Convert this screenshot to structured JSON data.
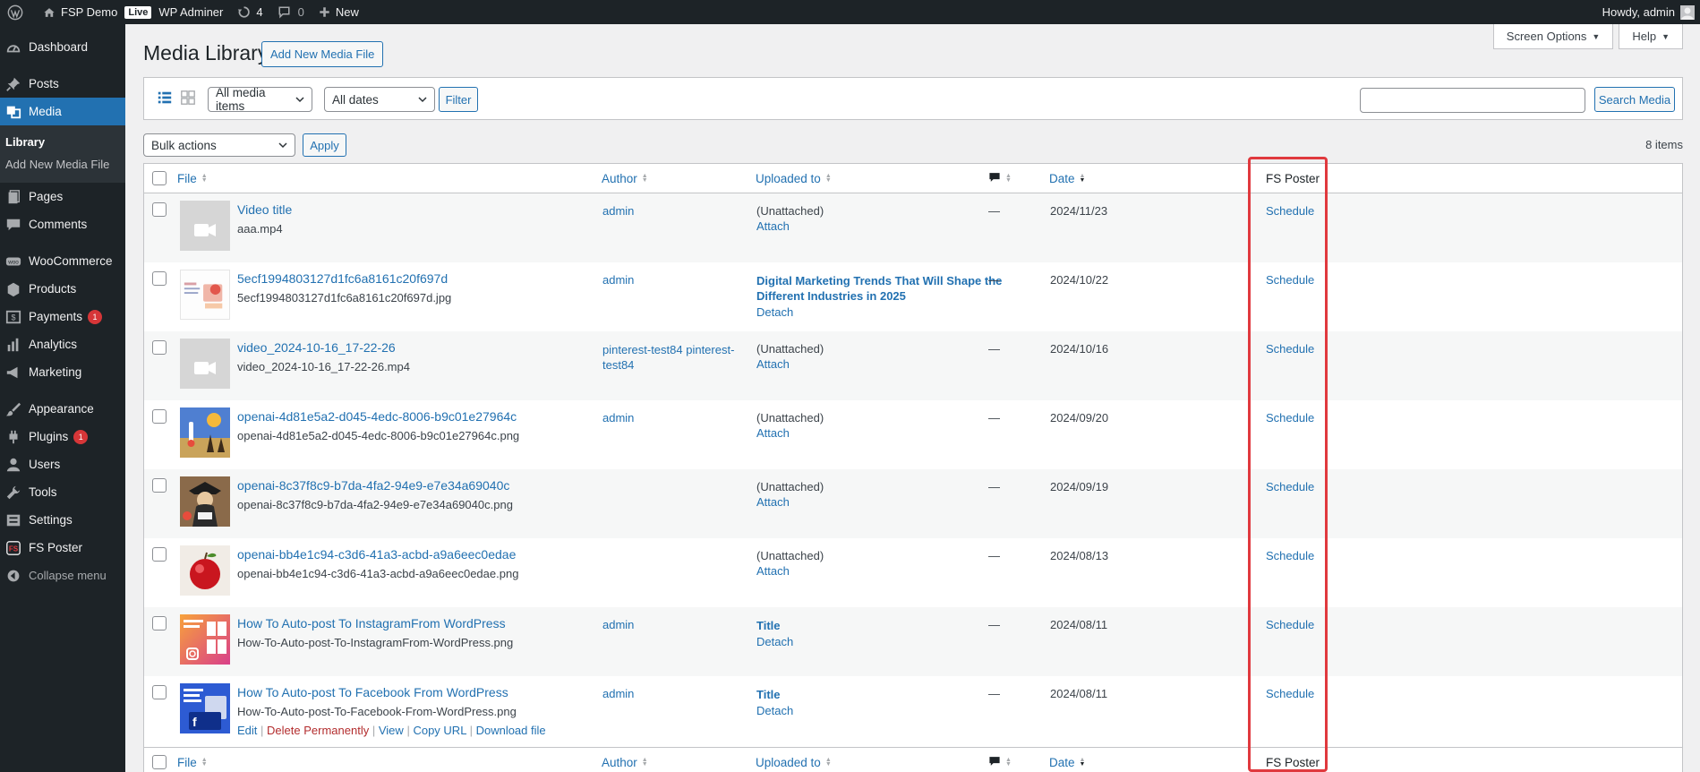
{
  "admin_bar": {
    "site_name": "FSP Demo",
    "live_badge": "Live",
    "wp_adminer": "WP Adminer",
    "updates_count": "4",
    "comments_count": "0",
    "new_label": "New",
    "howdy": "Howdy, admin"
  },
  "sidebar": {
    "dashboard": "Dashboard",
    "posts": "Posts",
    "media": "Media",
    "library": "Library",
    "add_new_media": "Add New Media File",
    "pages": "Pages",
    "comments": "Comments",
    "woocommerce": "WooCommerce",
    "products": "Products",
    "payments": "Payments",
    "payments_badge": "1",
    "analytics": "Analytics",
    "marketing": "Marketing",
    "appearance": "Appearance",
    "plugins": "Plugins",
    "plugins_badge": "1",
    "users": "Users",
    "tools": "Tools",
    "settings": "Settings",
    "fs_poster": "FS Poster",
    "collapse": "Collapse menu"
  },
  "header": {
    "title": "Media Library",
    "add_new": "Add New Media File",
    "screen_options": "Screen Options",
    "help": "Help"
  },
  "filters": {
    "media_type": "All media items",
    "dates": "All dates",
    "filter_button": "Filter",
    "search_button": "Search Media",
    "search_value": ""
  },
  "bulk": {
    "bulk_actions": "Bulk actions",
    "apply": "Apply",
    "items_count": "8 items"
  },
  "columns": {
    "file": "File",
    "author": "Author",
    "uploaded_to": "Uploaded to",
    "date": "Date",
    "fs_poster": "FS Poster"
  },
  "rows": [
    {
      "title": "Video title",
      "filename": "aaa.mp4",
      "author": "admin",
      "uploaded": "(Unattached)",
      "action": "Attach",
      "comments": "—",
      "date": "2024/11/23",
      "fs": "Schedule"
    },
    {
      "title": "5ecf1994803127d1fc6a8161c20f697d",
      "filename": "5ecf1994803127d1fc6a8161c20f697d.jpg",
      "author": "admin",
      "uploaded_line1": "Digital Marketing Trends That Will Shape the",
      "uploaded_line2": "Different Industries in 2025",
      "action": "Detach",
      "comments": "—",
      "date": "2024/10/22",
      "fs": "Schedule"
    },
    {
      "title": "video_2024-10-16_17-22-26",
      "filename": "video_2024-10-16_17-22-26.mp4",
      "author_line1": "pinterest-test84 pinterest-",
      "author_line2": "test84",
      "uploaded": "(Unattached)",
      "action": "Attach",
      "comments": "—",
      "date": "2024/10/16",
      "fs": "Schedule"
    },
    {
      "title": "openai-4d81e5a2-d045-4edc-8006-b9c01e27964c",
      "filename": "openai-4d81e5a2-d045-4edc-8006-b9c01e27964c.png",
      "author": "admin",
      "uploaded": "(Unattached)",
      "action": "Attach",
      "comments": "—",
      "date": "2024/09/20",
      "fs": "Schedule"
    },
    {
      "title": "openai-8c37f8c9-b7da-4fa2-94e9-e7e34a69040c",
      "filename": "openai-8c37f8c9-b7da-4fa2-94e9-e7e34a69040c.png",
      "author": "",
      "uploaded": "(Unattached)",
      "action": "Attach",
      "comments": "—",
      "date": "2024/09/19",
      "fs": "Schedule"
    },
    {
      "title": "openai-bb4e1c94-c3d6-41a3-acbd-a9a6eec0edae",
      "filename": "openai-bb4e1c94-c3d6-41a3-acbd-a9a6eec0edae.png",
      "author": "",
      "uploaded": "(Unattached)",
      "action": "Attach",
      "comments": "—",
      "date": "2024/08/13",
      "fs": "Schedule"
    },
    {
      "title": "How To Auto-post To InstagramFrom WordPress",
      "filename": "How-To-Auto-post-To-InstagramFrom-WordPress.png",
      "author": "admin",
      "uploaded": "Title",
      "action": "Detach",
      "comments": "—",
      "date": "2024/08/11",
      "fs": "Schedule"
    },
    {
      "title": "How To Auto-post To Facebook From WordPress",
      "filename": "How-To-Auto-post-To-Facebook-From-WordPress.png",
      "author": "admin",
      "uploaded": "Title",
      "action": "Detach",
      "comments": "—",
      "date": "2024/08/11",
      "fs": "Schedule"
    }
  ],
  "row_actions": {
    "edit": "Edit",
    "delete": "Delete Permanently",
    "view": "View",
    "copy_url": "Copy URL",
    "download": "Download file"
  },
  "colors": {
    "admin_bg": "#1d2327",
    "accent": "#2271b1",
    "highlight": "#e0393e",
    "badge": "#d63638"
  }
}
